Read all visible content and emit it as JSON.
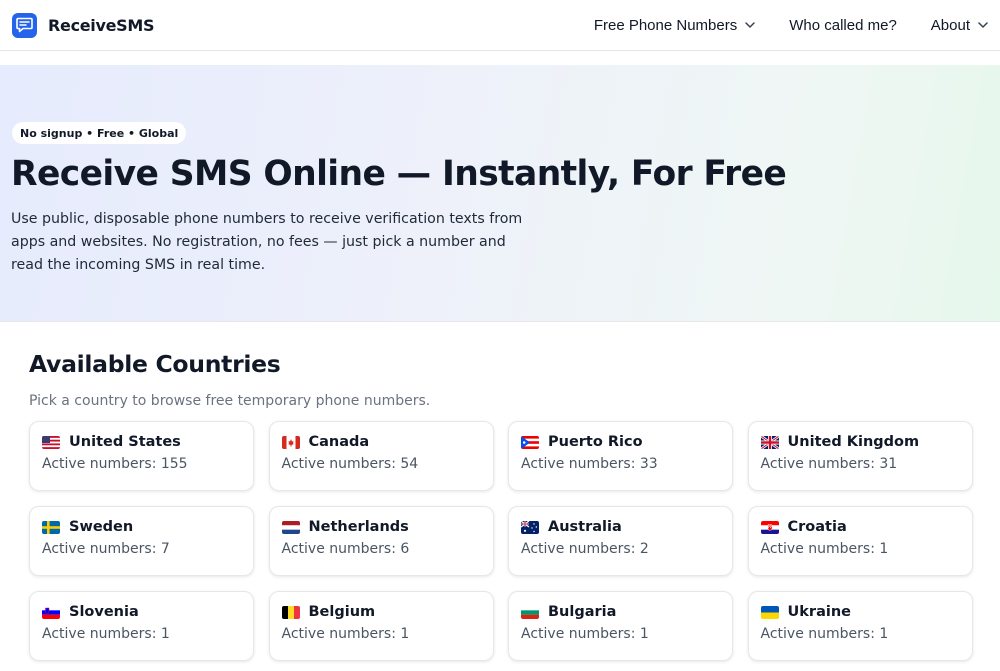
{
  "header": {
    "brand": "ReceiveSMS",
    "nav": [
      {
        "label": "Free Phone Numbers",
        "has_dropdown": true
      },
      {
        "label": "Who called me?",
        "has_dropdown": false
      },
      {
        "label": "About",
        "has_dropdown": true
      }
    ]
  },
  "hero": {
    "pill": "No signup • Free • Global",
    "title": "Receive SMS Online — Instantly, For Free",
    "description": "Use public, disposable phone numbers to receive verification texts from apps and websites. No registration, no fees — just pick a number and read the incoming SMS in real time."
  },
  "countries": {
    "title": "Available Countries",
    "subtitle": "Pick a country to browse free temporary phone numbers.",
    "items": [
      {
        "name": "United States",
        "count": "Active numbers: 155",
        "flag": "us-flag-icon"
      },
      {
        "name": "Canada",
        "count": "Active numbers: 54",
        "flag": "ca-flag-icon"
      },
      {
        "name": "Puerto Rico",
        "count": "Active numbers: 33",
        "flag": "pr-flag-icon"
      },
      {
        "name": "United Kingdom",
        "count": "Active numbers: 31",
        "flag": "gb-flag-icon"
      },
      {
        "name": "Sweden",
        "count": "Active numbers: 7",
        "flag": "se-flag-icon"
      },
      {
        "name": "Netherlands",
        "count": "Active numbers: 6",
        "flag": "nl-flag-icon"
      },
      {
        "name": "Australia",
        "count": "Active numbers: 2",
        "flag": "au-flag-icon"
      },
      {
        "name": "Croatia",
        "count": "Active numbers: 1",
        "flag": "hr-flag-icon"
      },
      {
        "name": "Slovenia",
        "count": "Active numbers: 1",
        "flag": "si-flag-icon"
      },
      {
        "name": "Belgium",
        "count": "Active numbers: 1",
        "flag": "be-flag-icon"
      },
      {
        "name": "Bulgaria",
        "count": "Active numbers: 1",
        "flag": "bg-flag-icon"
      },
      {
        "name": "Ukraine",
        "count": "Active numbers: 1",
        "flag": "ua-flag-icon"
      }
    ]
  },
  "colors": {
    "brand_blue": "#2563eb",
    "text_dark": "#111827",
    "text_muted": "#6b7280"
  }
}
